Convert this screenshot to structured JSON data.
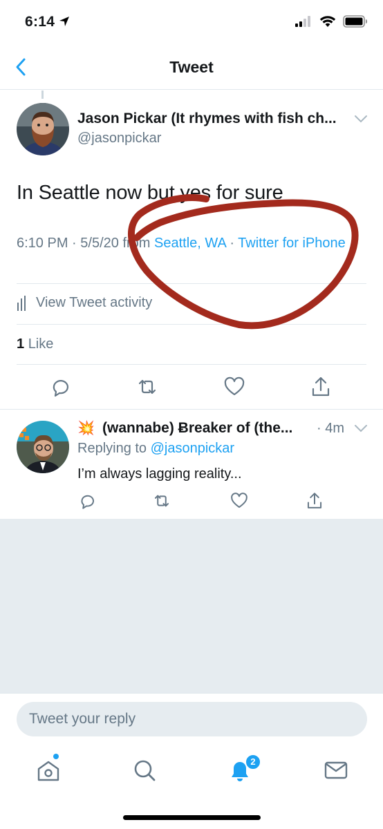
{
  "status_bar": {
    "time": "6:14"
  },
  "nav": {
    "title": "Tweet"
  },
  "tweet": {
    "author_name": "Jason Pickar (It rhymes with fish ch...",
    "author_handle": "@jasonpickar",
    "text": "In Seattle now but yes for sure",
    "time": "6:10 PM",
    "date": "5/5/20",
    "from_label": "from",
    "location": "Seattle, WA",
    "source": "Twitter for iPhone",
    "activity_label": "View Tweet activity",
    "like_count": "1",
    "like_label": "Like"
  },
  "reply": {
    "emoji": "💥",
    "author_name": "(wannabe) Ƀreaker of (the...",
    "time": "4m",
    "replying_label": "Replying to",
    "replying_handle": "@jasonpickar",
    "text": "I’m always lagging reality..."
  },
  "composer": {
    "placeholder": "Tweet your reply"
  },
  "tabs": {
    "notifications_badge": "2"
  },
  "colors": {
    "accent": "#1da1f2",
    "annotation": "#a32a1d",
    "secondary_text": "#657786"
  }
}
